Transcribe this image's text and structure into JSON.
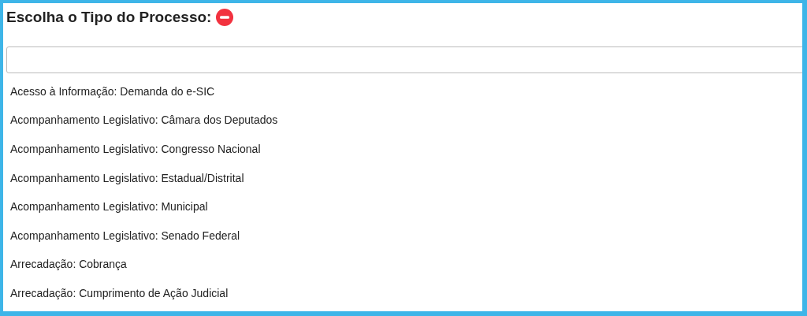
{
  "title": "Escolha o Tipo do Processo:",
  "items": [
    {
      "label": "Acesso à Informação: Demanda do e-SIC"
    },
    {
      "label": "Acompanhamento Legislativo: Câmara dos Deputados"
    },
    {
      "label": "Acompanhamento Legislativo: Congresso Nacional"
    },
    {
      "label": "Acompanhamento Legislativo: Estadual/Distrital"
    },
    {
      "label": "Acompanhamento Legislativo: Municipal"
    },
    {
      "label": "Acompanhamento Legislativo: Senado Federal"
    },
    {
      "label": "Arrecadação: Cobrança"
    },
    {
      "label": "Arrecadação: Cumprimento de Ação Judicial"
    }
  ]
}
